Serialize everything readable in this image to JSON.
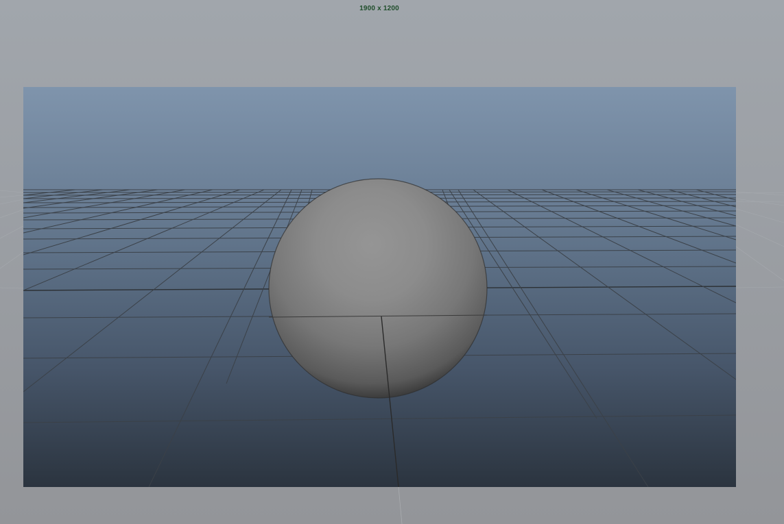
{
  "viewport": {
    "resolution_gate_label": "1900 x 1200",
    "colors": {
      "outside_gate_top": "#a1a6ac",
      "outside_gate_bottom": "#94969a",
      "sky_top": "#7e93ab",
      "horizon": "#5f738a",
      "ground_bottom": "#2c3540",
      "grid_line": "#3a3f44",
      "grid_axis": "#2a2d30",
      "sphere_light": "#959595",
      "sphere_dark": "#3a3a3a",
      "label": "#1f4e2b"
    },
    "objects": [
      {
        "type": "sphere",
        "name": "sphere",
        "shading": "smooth-shaded"
      },
      {
        "type": "grid",
        "name": "ground-grid"
      }
    ]
  }
}
